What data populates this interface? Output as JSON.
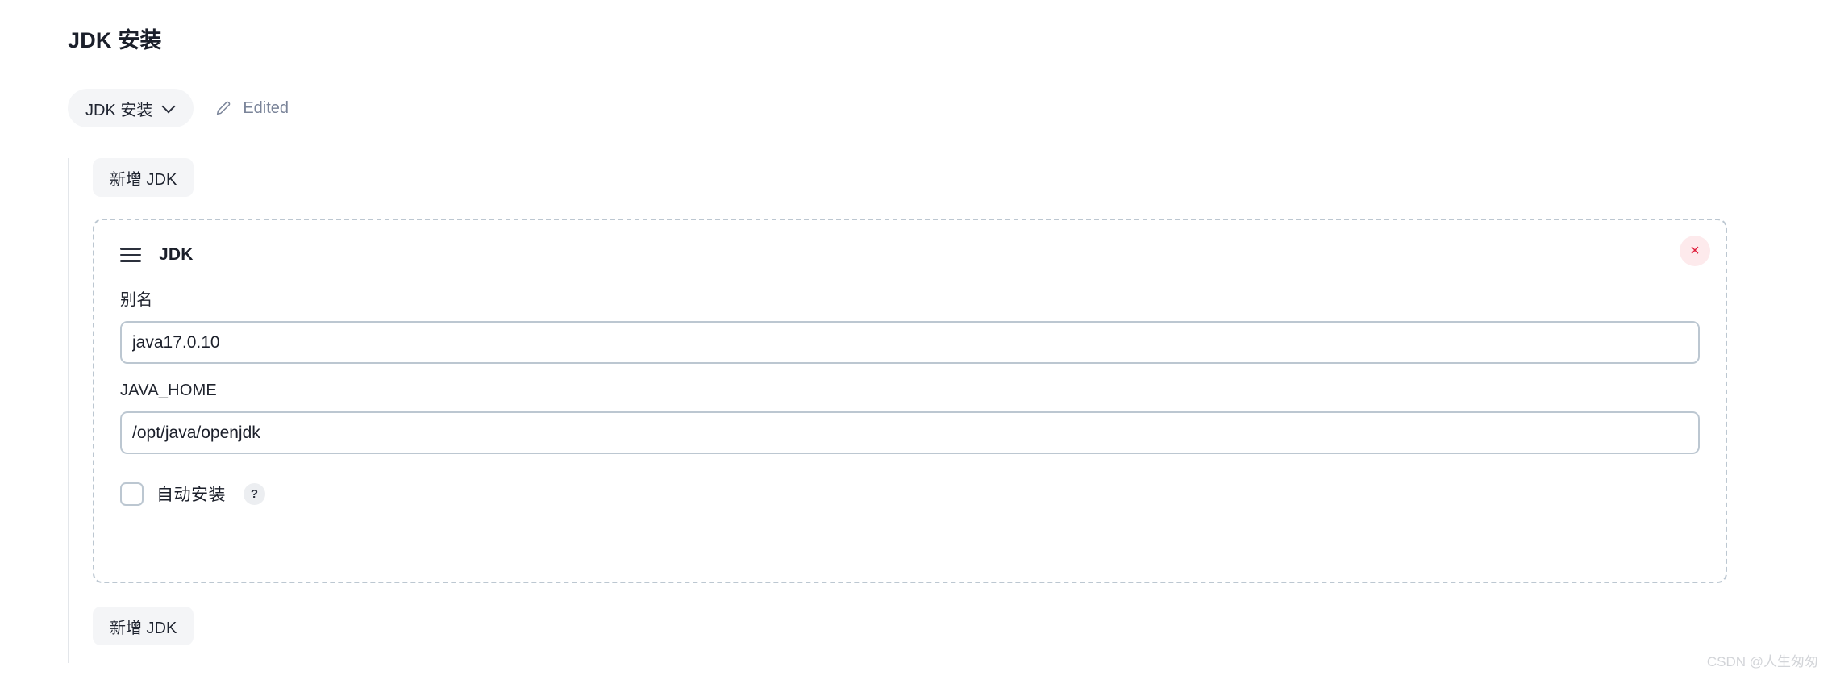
{
  "page": {
    "title": "JDK 安装"
  },
  "meta": {
    "crumb_label": "JDK 安装",
    "chevron_icon": "chevron-down-icon",
    "pencil_icon": "pencil-icon",
    "edited_label": "Edited"
  },
  "section": {
    "add_button_top": "新增 JDK",
    "add_button_bottom": "新增 JDK"
  },
  "block": {
    "drag_icon": "drag-handle-icon",
    "title": "JDK",
    "close_icon": "close-icon",
    "close_label": "×",
    "fields": [
      {
        "label": "别名",
        "value": "java17.0.10",
        "placeholder": "别名"
      },
      {
        "label": "JAVA_HOME",
        "value": "/opt/java/openjdk",
        "placeholder": "JAVA_HOME"
      }
    ],
    "checkbox": {
      "label": "自动安装",
      "checked": false,
      "help_label": "?"
    }
  },
  "watermark": "CSDN @人生匆匆",
  "colors": {
    "pill_bg": "#f4f5f7",
    "dashed_border": "#bcc7d1",
    "input_border": "#bcc7d1",
    "close_bg": "#fdeaec",
    "close_fg": "#e01e3c",
    "muted_text": "#7a8499",
    "rail": "#e3e6ea"
  }
}
